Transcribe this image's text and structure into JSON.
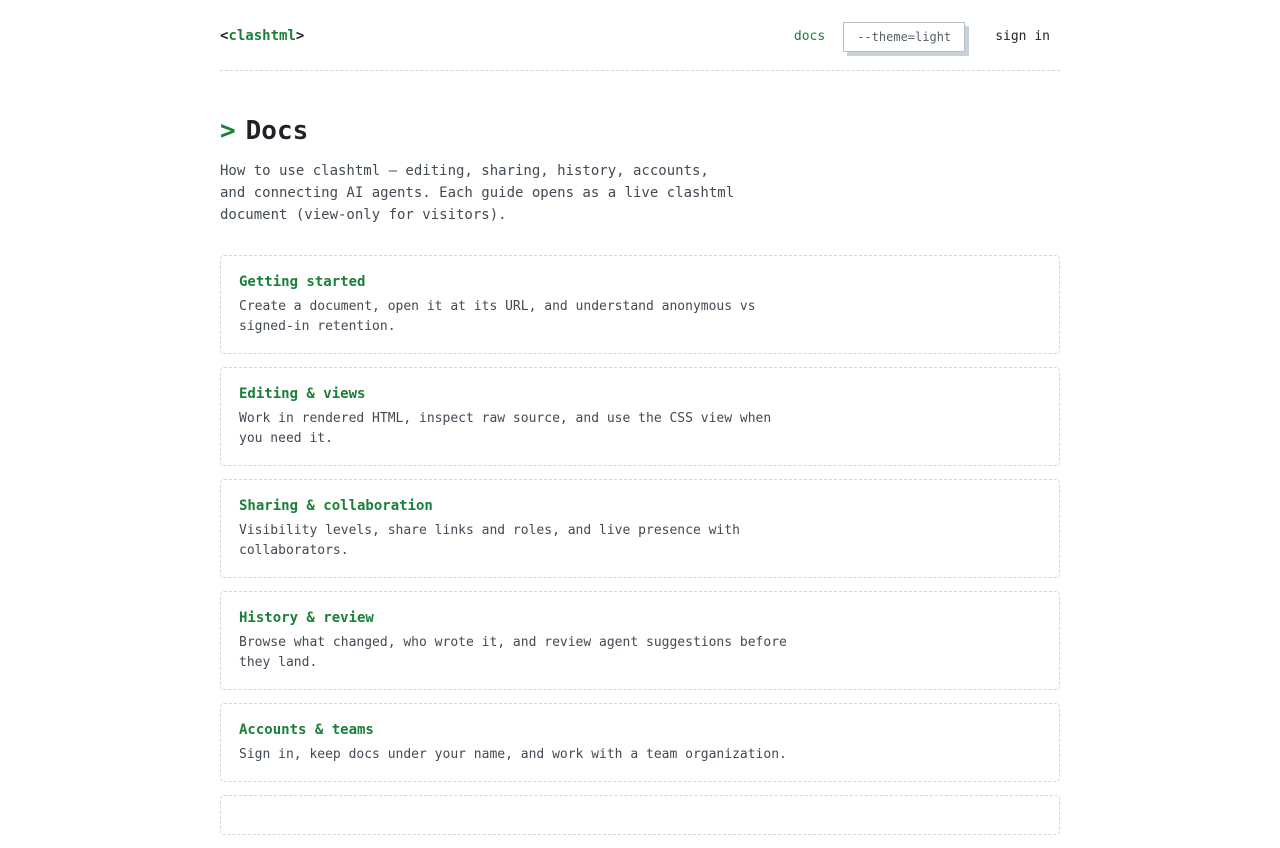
{
  "header": {
    "logo_open": "<",
    "logo_name": "clashtml",
    "logo_close": ">",
    "nav_docs": "docs",
    "theme_toggle": "--theme=light",
    "sign_in": "sign in"
  },
  "hero": {
    "prompt": ">",
    "title": "Docs",
    "intro": "How to use clashtml — editing, sharing, history, accounts, and connecting AI agents. Each guide opens as a live clashtml document (view-only for visitors)."
  },
  "guides": [
    {
      "title": "Getting started",
      "description": "Create a document, open it at its URL, and understand anonymous vs signed-in retention."
    },
    {
      "title": "Editing & views",
      "description": "Work in rendered HTML, inspect raw source, and use the CSS view when you need it."
    },
    {
      "title": "Sharing & collaboration",
      "description": "Visibility levels, share links and roles, and live presence with collaborators."
    },
    {
      "title": "History & review",
      "description": "Browse what changed, who wrote it, and review agent suggestions before they land."
    },
    {
      "title": "Accounts & teams",
      "description": "Sign in, keep docs under your name, and work with a team organization."
    }
  ],
  "colors": {
    "accent": "#1a7f37",
    "text": "#1f2328",
    "muted": "#424a53",
    "border": "#d0d7de"
  }
}
